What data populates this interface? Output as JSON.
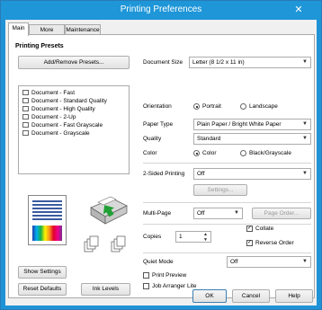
{
  "window": {
    "title": "Printing Preferences",
    "close_icon": "close-icon"
  },
  "tabs": [
    "Main",
    "More Options",
    "Maintenance"
  ],
  "presets": {
    "heading": "Printing Presets",
    "add_button": "Add/Remove Presets...",
    "items": [
      "Document - Fast",
      "Document - Standard Quality",
      "Document - High Quality",
      "Document - 2-Up",
      "Document - Fast Grayscale",
      "Document - Grayscale"
    ]
  },
  "fields": {
    "document_size": {
      "label": "Document Size",
      "value": "Letter (8 1/2 x 11 in)"
    },
    "orientation": {
      "label": "Orientation",
      "options": [
        "Portrait",
        "Landscape"
      ],
      "selected": "Portrait"
    },
    "paper_type": {
      "label": "Paper Type",
      "value": "Plain Paper / Bright White Paper"
    },
    "quality": {
      "label": "Quality",
      "value": "Standard"
    },
    "color": {
      "label": "Color",
      "options": [
        "Color",
        "Black/Grayscale"
      ],
      "selected": "Color"
    },
    "two_sided": {
      "label": "2-Sided Printing",
      "value": "Off",
      "settings_button": "Settings..."
    },
    "multi_page": {
      "label": "Multi-Page",
      "value": "Off",
      "page_order_button": "Page Order..."
    },
    "copies": {
      "label": "Copies",
      "value": "1"
    },
    "collate": {
      "label": "Collate",
      "checked": true
    },
    "reverse_order": {
      "label": "Reverse Order",
      "checked": true
    },
    "quiet_mode": {
      "label": "Quiet Mode",
      "value": "Off"
    },
    "print_preview": {
      "label": "Print Preview",
      "checked": false
    },
    "job_arranger": {
      "label": "Job Arranger Lite",
      "checked": false
    }
  },
  "left_buttons": {
    "show_settings": "Show Settings",
    "reset_defaults": "Reset Defaults",
    "ink_levels": "Ink Levels"
  },
  "footer": {
    "ok": "OK",
    "cancel": "Cancel",
    "help": "Help"
  },
  "colors": {
    "titlebar": "#1e96d8",
    "ink": [
      "#00aeef",
      "#ec008c",
      "#fff200",
      "#000000"
    ]
  }
}
